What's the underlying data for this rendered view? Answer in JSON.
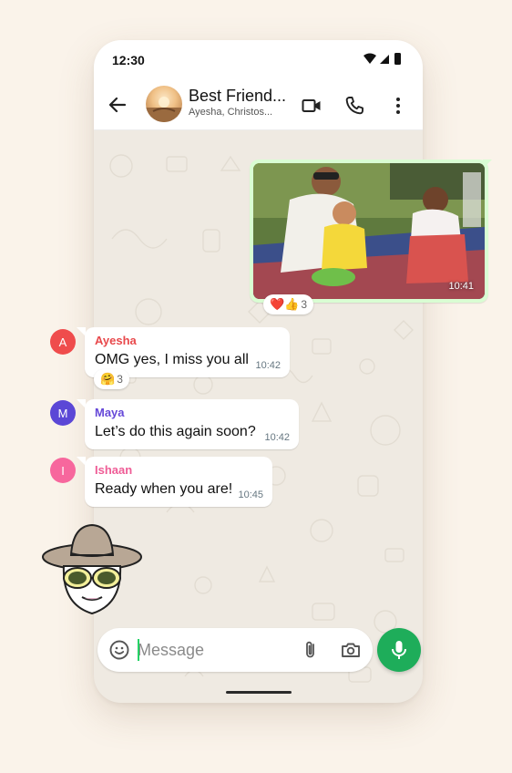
{
  "status_bar": {
    "time": "12:30"
  },
  "header": {
    "title": "Best Friend...",
    "subtitle": "Ayesha, Christos..."
  },
  "photo_message": {
    "time": "10:41",
    "reaction": {
      "emojis": "❤️👍",
      "count": "3"
    }
  },
  "messages": [
    {
      "sender": "Ayesha",
      "initial": "A",
      "sender_color": "#e8484b",
      "avatar_color": "#ef4c4c",
      "text": "OMG yes, I miss you all",
      "time": "10:42",
      "reaction": {
        "emojis": "🤗",
        "count": "3"
      }
    },
    {
      "sender": "Maya",
      "initial": "M",
      "sender_color": "#6548d8",
      "avatar_color": "#5b47d6",
      "text": "Let’s do this again soon?",
      "time": "10:42"
    },
    {
      "sender": "Ishaan",
      "initial": "I",
      "sender_color": "#ef5c96",
      "avatar_color": "#f7679d",
      "text": "Ready when you are!",
      "time": "10:45"
    }
  ],
  "composer": {
    "placeholder": "Message"
  },
  "colors": {
    "accent": "#1ead5a",
    "outgoing_bubble": "#d9fdd3",
    "chat_background": "#efeae2"
  }
}
